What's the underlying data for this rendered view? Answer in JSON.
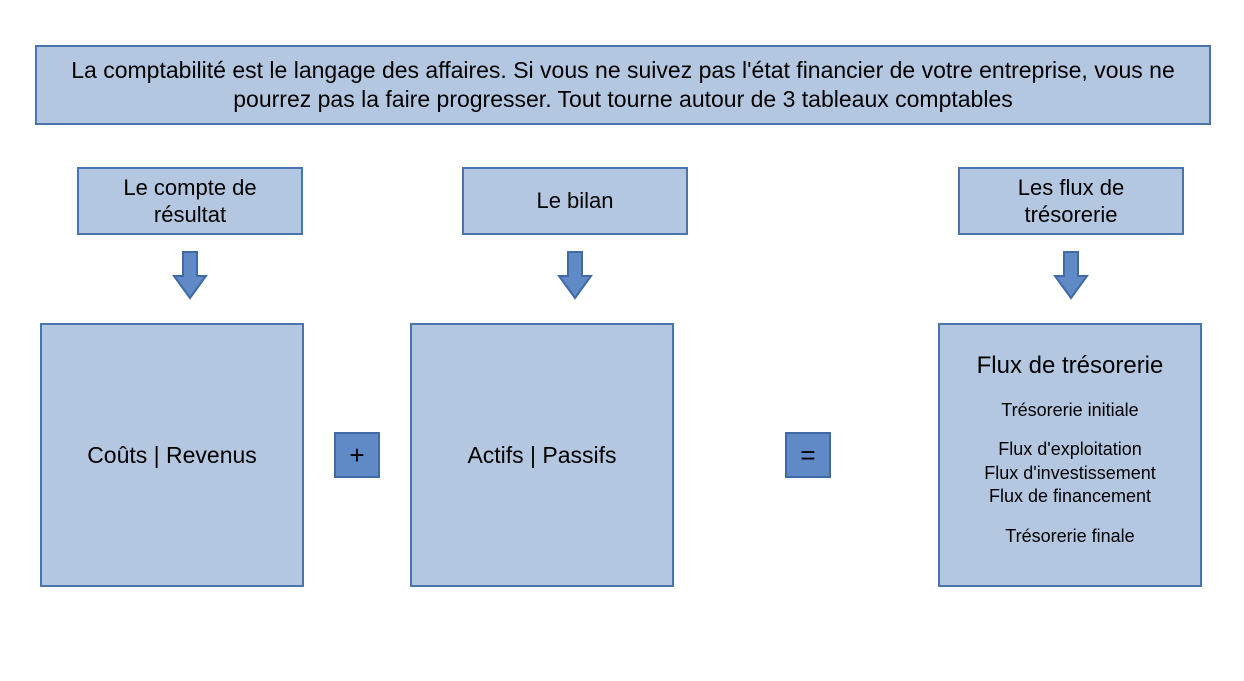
{
  "banner": "La comptabilité est le langage des affaires. Si vous ne suivez pas l'état financier de votre entreprise, vous ne pourrez pas la faire progresser. Tout tourne autour de 3 tableaux comptables",
  "columns": {
    "col1": {
      "head": "Le compte de résultat",
      "body": "Coûts | Revenus"
    },
    "col2": {
      "head": "Le bilan",
      "body": "Actifs | Passifs"
    },
    "col3": {
      "head": "Les flux de trésorerie",
      "flux_title": "Flux de trésorerie",
      "line1": "Trésorerie initiale",
      "line2": "Flux d'exploitation",
      "line3": "Flux d'investissement",
      "line4": "Flux de financement",
      "line5": "Trésorerie finale"
    }
  },
  "operators": {
    "plus": "+",
    "equals": "="
  },
  "style": {
    "box_fill": "#b3c7e1",
    "box_border": "#4a74ae",
    "op_fill": "#5f8ac6",
    "arrow_fill": "#5f8ac6",
    "arrow_border": "#3f6aa6"
  }
}
